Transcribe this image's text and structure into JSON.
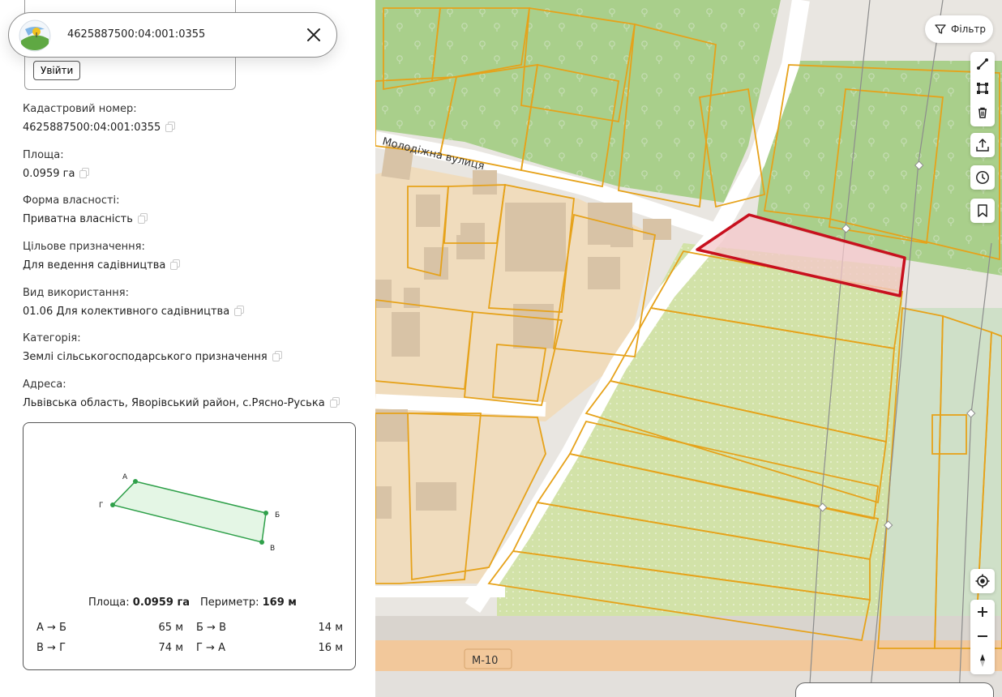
{
  "search": {
    "query": "4625887500:04:001:0355"
  },
  "login": {
    "button_label": "Увійти"
  },
  "parcel": {
    "cadastral": {
      "label": "Кадастровий номер:",
      "value": "4625887500:04:001:0355"
    },
    "area": {
      "label": "Площа:",
      "value": "0.0959 га"
    },
    "ownership": {
      "label": "Форма власності:",
      "value": "Приватна власність"
    },
    "purpose": {
      "label": "Цільове призначення:",
      "value": "Для ведення садівництва"
    },
    "usage": {
      "label": "Вид використання:",
      "value": "01.06 Для колективного садівництва"
    },
    "category": {
      "label": "Категорія:",
      "value": "Землі сільськогосподарського призначення"
    },
    "address": {
      "label": "Адреса:",
      "value": "Львівська область, Яворівський район, с.Рясно-Руська"
    }
  },
  "shape": {
    "vertices": [
      "А",
      "Б",
      "В",
      "Г"
    ],
    "area_label": "Площа:",
    "area_value": "0.0959 га",
    "perimeter_label": "Периметр:",
    "perimeter_value": "169 м",
    "segments": [
      {
        "name": "А → Б",
        "length": "65 м"
      },
      {
        "name": "Б → В",
        "length": "14 м"
      },
      {
        "name": "В → Г",
        "length": "74 м"
      },
      {
        "name": "Г → А",
        "length": "16 м"
      }
    ]
  },
  "map": {
    "street_label": "Молодіжна вулиця",
    "road_label": "М-10",
    "filter_label": "Фільтр",
    "colors": {
      "parcel_outline": "#e6a21a",
      "selected_outline": "#c8101e",
      "selected_fill": "#f4c7c9",
      "green_area": "#a9cf8b",
      "beige_area": "#f3dfbb",
      "road": "#ffffff",
      "map_bg": "#e9e6e1"
    }
  },
  "icons": {
    "filter": "funnel-icon",
    "line": "draw-line-icon",
    "polygon": "draw-polygon-icon",
    "delete": "trash-icon",
    "export": "upload-icon",
    "history": "clock-icon",
    "bookmark": "bookmark-icon",
    "locate": "locate-icon",
    "zoom_in": "plus-icon",
    "zoom_out": "minus-icon",
    "compass": "compass-icon",
    "close": "close-icon",
    "copy": "copy-icon"
  }
}
